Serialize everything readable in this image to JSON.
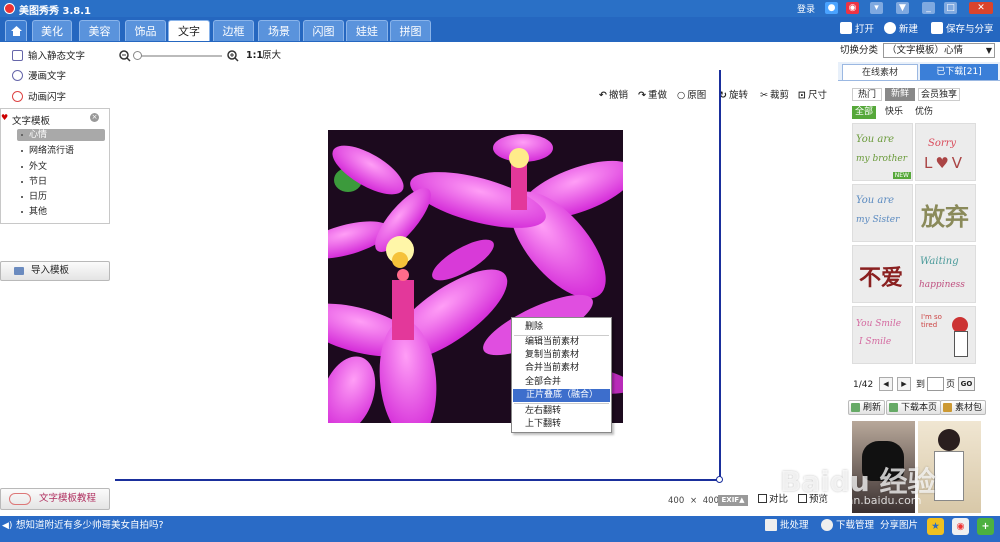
{
  "app": {
    "title": "美图秀秀 3.8.1",
    "login": "登录"
  },
  "nav": {
    "tabs": [
      "美化",
      "美容",
      "饰品",
      "文字",
      "边框",
      "场景",
      "闪图",
      "娃娃",
      "拼图"
    ],
    "active": "文字",
    "open": "打开",
    "new": "新建",
    "save_share": "保存与分享"
  },
  "left": {
    "input_static_text": "输入静态文字",
    "comic_text": "漫画文字",
    "animated_text": "动画闪字",
    "template_header": "文字模板",
    "template_items": [
      "心情",
      "网络流行语",
      "外文",
      "节日",
      "日历",
      "其他"
    ],
    "import_template": "导入模板",
    "tutorial": "文字模板教程"
  },
  "toolbar": {
    "ratio": "1:1",
    "original_size": "原大",
    "undo": "撤销",
    "redo": "重做",
    "original": "原图",
    "rotate": "旋转",
    "crop": "裁剪",
    "resize": "尺寸"
  },
  "context_menu": {
    "items": [
      "删除",
      "编辑当前素材",
      "复制当前素材",
      "合并当前素材",
      "全部合并",
      "正片叠底（融合）",
      "左右翻转",
      "上下翻转"
    ],
    "selected": "正片叠底（融合）"
  },
  "status": {
    "width": "400",
    "times": "×",
    "height": "400",
    "exif": "EXIF▲",
    "compare": "对比",
    "preview": "预览"
  },
  "right": {
    "switch_label": "切换分类",
    "category_value": "（文字模板）心情",
    "tabs": [
      "在线素材",
      "已下载[21]"
    ],
    "filter": [
      "热门",
      "新鲜",
      "会员独享"
    ],
    "subfilter": [
      "全部",
      "快乐",
      "优伤"
    ],
    "stickers": [
      {
        "line1": "You are",
        "line2": "my brother",
        "new": "NEW"
      },
      {
        "line1": "Sorry",
        "line2": "L♥V"
      },
      {
        "line1": "You are",
        "line2": "my Sister"
      },
      {
        "line1": "放弃",
        "line2": ""
      },
      {
        "line1": "不爱",
        "line2": ""
      },
      {
        "line1": "Waiting",
        "line2": "happiness"
      },
      {
        "line1": "You Smile",
        "line2": "I Smile"
      },
      {
        "line1": "I'm so",
        "line2": "tired"
      }
    ],
    "page": "1/42",
    "goto": "到",
    "page_unit": "页",
    "go": "GO",
    "refresh": "刷新",
    "download_page": "下载本页",
    "material_pack": "素材包"
  },
  "bottom": {
    "tip": "想知道附近有多少帅哥美女自拍吗?",
    "batch": "批处理",
    "download_manage": "下载管理",
    "share_image": "分享图片"
  },
  "watermark": {
    "brand": "Baidu 经验",
    "url": "jingyan.baidu.com"
  },
  "colors": {
    "title_bar": "#2a70c6",
    "nav_bar": "#2567c0",
    "guide_line": "#1a2f9c",
    "menu_highlight": "#3d6ecc",
    "flower": "#e040e6"
  }
}
